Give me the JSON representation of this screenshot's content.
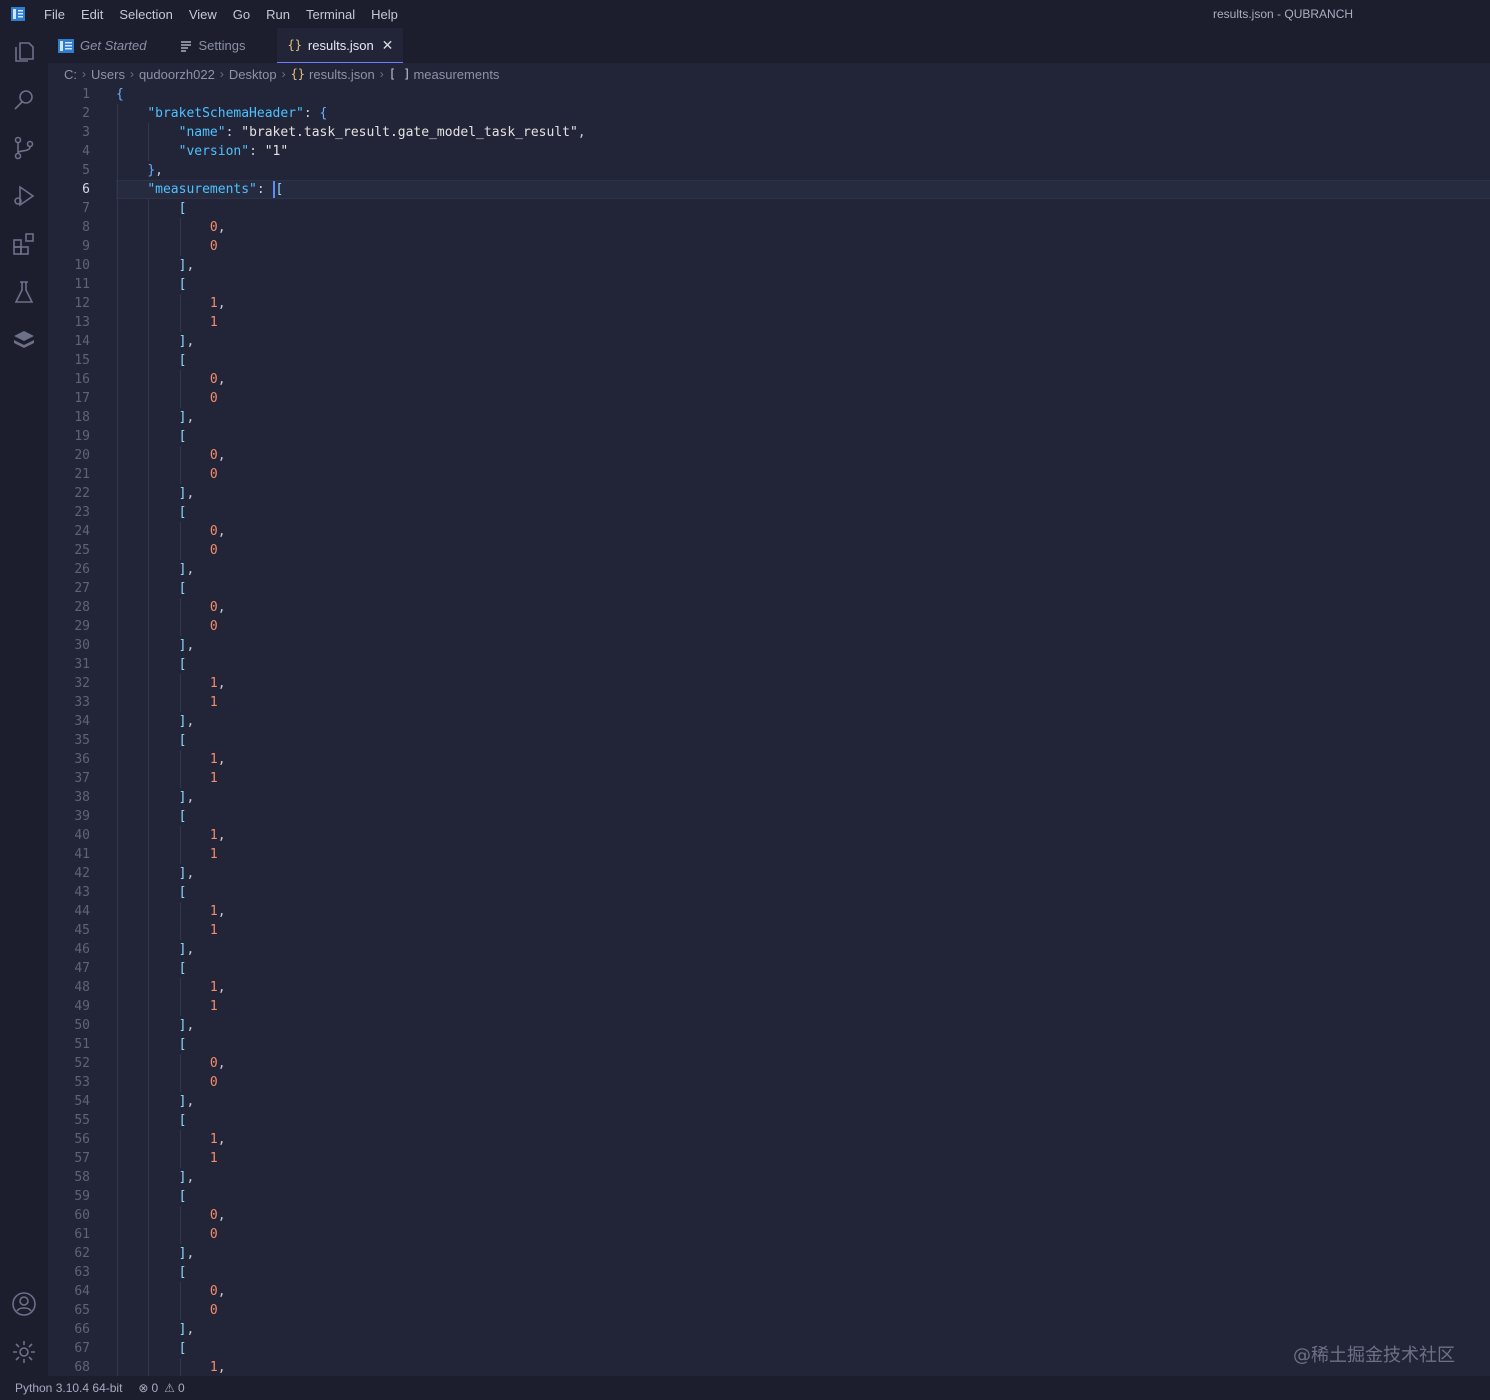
{
  "menu": [
    "File",
    "Edit",
    "Selection",
    "View",
    "Go",
    "Run",
    "Terminal",
    "Help"
  ],
  "window_title": "results.json - QUBRANCH",
  "activity_icons": [
    "explorer-icon",
    "search-icon",
    "source-control-icon",
    "run-debug-icon",
    "extensions-icon",
    "testing-icon",
    "layers-icon"
  ],
  "tabs": [
    {
      "label": "Get Started",
      "icon": "vscode-logo-icon"
    },
    {
      "label": "Settings",
      "icon": "settings-lines-icon"
    },
    {
      "label": "results.json",
      "icon": "json-braces-icon",
      "active": true
    }
  ],
  "breadcrumb": {
    "parts": [
      "C:",
      "Users",
      "qudoorzh022",
      "Desktop",
      "results.json",
      "measurements"
    ],
    "json_icon": "{}",
    "array_icon": "[ ]"
  },
  "editor": {
    "current_line": 6,
    "lines": [
      "{",
      "    \"braketSchemaHeader\": {",
      "        \"name\": \"braket.task_result.gate_model_task_result\",",
      "        \"version\": \"1\"",
      "    },",
      "    \"measurements\": [",
      "        [",
      "            0,",
      "            0",
      "        ],",
      "        [",
      "            1,",
      "            1",
      "        ],",
      "        [",
      "            0,",
      "            0",
      "        ],",
      "        [",
      "            0,",
      "            0",
      "        ],",
      "        [",
      "            0,",
      "            0",
      "        ],",
      "        [",
      "            0,",
      "            0",
      "        ],",
      "        [",
      "            1,",
      "            1",
      "        ],",
      "        [",
      "            1,",
      "            1",
      "        ],",
      "        [",
      "            1,",
      "            1",
      "        ],",
      "        [",
      "            1,",
      "            1",
      "        ],",
      "        [",
      "            1,",
      "            1",
      "        ],",
      "        [",
      "            0,",
      "            0",
      "        ],",
      "        [",
      "            1,",
      "            1",
      "        ],",
      "        [",
      "            0,",
      "            0",
      "        ],",
      "        [",
      "            0,",
      "            0",
      "        ],",
      "        [",
      "            1,"
    ]
  },
  "status": {
    "python": "Python 3.10.4 64-bit",
    "errors": "0",
    "warnings": "0"
  },
  "watermark": "@稀土掘金技术社区",
  "colors": {
    "background": "#222537",
    "chrome": "#1c1e2e",
    "accent": "#6f7cff",
    "number": "#f78c6c",
    "key": "#4fc1ff"
  }
}
